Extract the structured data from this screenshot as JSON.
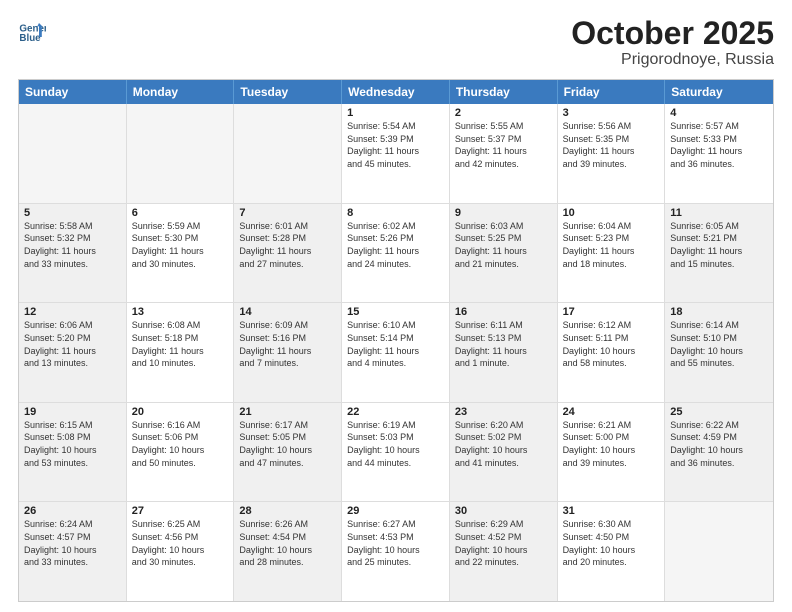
{
  "header": {
    "logo_line1": "General",
    "logo_line2": "Blue",
    "month": "October 2025",
    "location": "Prigorodnoye, Russia"
  },
  "weekdays": [
    "Sunday",
    "Monday",
    "Tuesday",
    "Wednesday",
    "Thursday",
    "Friday",
    "Saturday"
  ],
  "rows": [
    [
      {
        "day": "",
        "text": "",
        "empty": true
      },
      {
        "day": "",
        "text": "",
        "empty": true
      },
      {
        "day": "",
        "text": "",
        "empty": true
      },
      {
        "day": "1",
        "text": "Sunrise: 5:54 AM\nSunset: 5:39 PM\nDaylight: 11 hours\nand 45 minutes."
      },
      {
        "day": "2",
        "text": "Sunrise: 5:55 AM\nSunset: 5:37 PM\nDaylight: 11 hours\nand 42 minutes."
      },
      {
        "day": "3",
        "text": "Sunrise: 5:56 AM\nSunset: 5:35 PM\nDaylight: 11 hours\nand 39 minutes."
      },
      {
        "day": "4",
        "text": "Sunrise: 5:57 AM\nSunset: 5:33 PM\nDaylight: 11 hours\nand 36 minutes."
      }
    ],
    [
      {
        "day": "5",
        "text": "Sunrise: 5:58 AM\nSunset: 5:32 PM\nDaylight: 11 hours\nand 33 minutes.",
        "shaded": true
      },
      {
        "day": "6",
        "text": "Sunrise: 5:59 AM\nSunset: 5:30 PM\nDaylight: 11 hours\nand 30 minutes."
      },
      {
        "day": "7",
        "text": "Sunrise: 6:01 AM\nSunset: 5:28 PM\nDaylight: 11 hours\nand 27 minutes.",
        "shaded": true
      },
      {
        "day": "8",
        "text": "Sunrise: 6:02 AM\nSunset: 5:26 PM\nDaylight: 11 hours\nand 24 minutes."
      },
      {
        "day": "9",
        "text": "Sunrise: 6:03 AM\nSunset: 5:25 PM\nDaylight: 11 hours\nand 21 minutes.",
        "shaded": true
      },
      {
        "day": "10",
        "text": "Sunrise: 6:04 AM\nSunset: 5:23 PM\nDaylight: 11 hours\nand 18 minutes."
      },
      {
        "day": "11",
        "text": "Sunrise: 6:05 AM\nSunset: 5:21 PM\nDaylight: 11 hours\nand 15 minutes.",
        "shaded": true
      }
    ],
    [
      {
        "day": "12",
        "text": "Sunrise: 6:06 AM\nSunset: 5:20 PM\nDaylight: 11 hours\nand 13 minutes.",
        "shaded": true
      },
      {
        "day": "13",
        "text": "Sunrise: 6:08 AM\nSunset: 5:18 PM\nDaylight: 11 hours\nand 10 minutes."
      },
      {
        "day": "14",
        "text": "Sunrise: 6:09 AM\nSunset: 5:16 PM\nDaylight: 11 hours\nand 7 minutes.",
        "shaded": true
      },
      {
        "day": "15",
        "text": "Sunrise: 6:10 AM\nSunset: 5:14 PM\nDaylight: 11 hours\nand 4 minutes."
      },
      {
        "day": "16",
        "text": "Sunrise: 6:11 AM\nSunset: 5:13 PM\nDaylight: 11 hours\nand 1 minute.",
        "shaded": true
      },
      {
        "day": "17",
        "text": "Sunrise: 6:12 AM\nSunset: 5:11 PM\nDaylight: 10 hours\nand 58 minutes."
      },
      {
        "day": "18",
        "text": "Sunrise: 6:14 AM\nSunset: 5:10 PM\nDaylight: 10 hours\nand 55 minutes.",
        "shaded": true
      }
    ],
    [
      {
        "day": "19",
        "text": "Sunrise: 6:15 AM\nSunset: 5:08 PM\nDaylight: 10 hours\nand 53 minutes.",
        "shaded": true
      },
      {
        "day": "20",
        "text": "Sunrise: 6:16 AM\nSunset: 5:06 PM\nDaylight: 10 hours\nand 50 minutes."
      },
      {
        "day": "21",
        "text": "Sunrise: 6:17 AM\nSunset: 5:05 PM\nDaylight: 10 hours\nand 47 minutes.",
        "shaded": true
      },
      {
        "day": "22",
        "text": "Sunrise: 6:19 AM\nSunset: 5:03 PM\nDaylight: 10 hours\nand 44 minutes."
      },
      {
        "day": "23",
        "text": "Sunrise: 6:20 AM\nSunset: 5:02 PM\nDaylight: 10 hours\nand 41 minutes.",
        "shaded": true
      },
      {
        "day": "24",
        "text": "Sunrise: 6:21 AM\nSunset: 5:00 PM\nDaylight: 10 hours\nand 39 minutes."
      },
      {
        "day": "25",
        "text": "Sunrise: 6:22 AM\nSunset: 4:59 PM\nDaylight: 10 hours\nand 36 minutes.",
        "shaded": true
      }
    ],
    [
      {
        "day": "26",
        "text": "Sunrise: 6:24 AM\nSunset: 4:57 PM\nDaylight: 10 hours\nand 33 minutes.",
        "shaded": true
      },
      {
        "day": "27",
        "text": "Sunrise: 6:25 AM\nSunset: 4:56 PM\nDaylight: 10 hours\nand 30 minutes."
      },
      {
        "day": "28",
        "text": "Sunrise: 6:26 AM\nSunset: 4:54 PM\nDaylight: 10 hours\nand 28 minutes.",
        "shaded": true
      },
      {
        "day": "29",
        "text": "Sunrise: 6:27 AM\nSunset: 4:53 PM\nDaylight: 10 hours\nand 25 minutes."
      },
      {
        "day": "30",
        "text": "Sunrise: 6:29 AM\nSunset: 4:52 PM\nDaylight: 10 hours\nand 22 minutes.",
        "shaded": true
      },
      {
        "day": "31",
        "text": "Sunrise: 6:30 AM\nSunset: 4:50 PM\nDaylight: 10 hours\nand 20 minutes."
      },
      {
        "day": "",
        "text": "",
        "empty": true
      }
    ]
  ]
}
